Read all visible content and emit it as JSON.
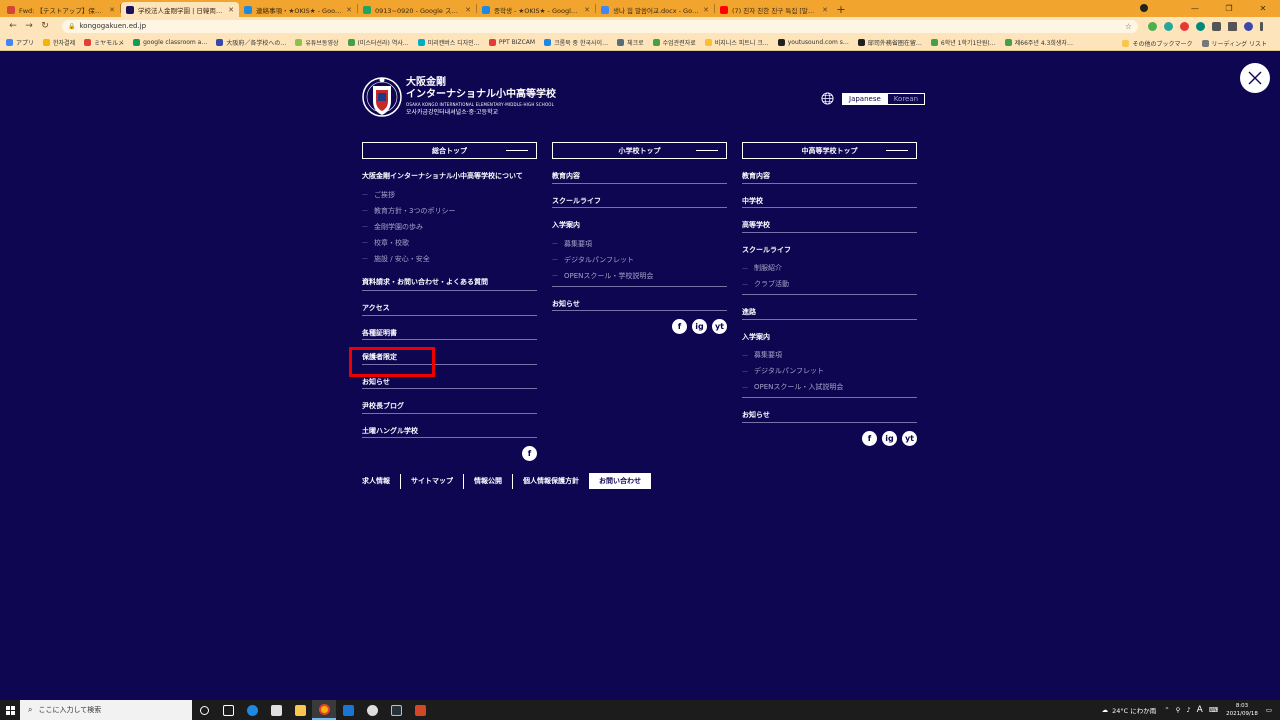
{
  "browser": {
    "tabs": [
      {
        "label": "Fwd: 【テストアップ】保護者ページ:ユ…",
        "icon_color": "#d44638"
      },
      {
        "label": "学校法人金剛学園 | 日韓両国語で…",
        "icon_color": "#1a1060",
        "active": true
      },
      {
        "label": "連絡事項・★OKIS★ - Google ド…",
        "icon_color": "#1e88e5"
      },
      {
        "label": "0913~0920 - Google スプレッドシー…",
        "icon_color": "#1fa463"
      },
      {
        "label": "중학생 - ★OKIS★ - Google ドラ…",
        "icon_color": "#1e88e5"
      },
      {
        "label": "생나 힘 말씀어교.docx - Google…",
        "icon_color": "#4285f4"
      },
      {
        "label": "(7) 친자 친한 친구 특집 [말씀어…",
        "icon_color": "#ff0000"
      }
    ],
    "new_tab": "+",
    "url": "kongogakuen.ed.jp",
    "bookmarks": [
      {
        "label": "アプリ",
        "color": "#4285f4"
      },
      {
        "label": "한자결제",
        "color": "#f4b400"
      },
      {
        "label": "ミヤモルメ",
        "color": "#db4437"
      },
      {
        "label": "google classroom a…",
        "color": "#0f9d58"
      },
      {
        "label": "大阪府／各学校への…",
        "color": "#3949ab"
      },
      {
        "label": "유튜브동영상",
        "color": "#8bc34a"
      },
      {
        "label": "(미스터선라) 역사…",
        "color": "#43a047"
      },
      {
        "label": "미리캔버스 디자인…",
        "color": "#00acc1"
      },
      {
        "label": "PPT BIZCAM",
        "color": "#e53935"
      },
      {
        "label": "크롬북 중 한국사이…",
        "color": "#1e88e5"
      },
      {
        "label": "체크로",
        "color": "#546e7a"
      },
      {
        "label": "수업관련자료",
        "color": "#43a047"
      },
      {
        "label": "비지니스 피트니 크…",
        "color": "#fbc02d"
      },
      {
        "label": "youtusound.com s…",
        "color": "#212121"
      },
      {
        "label": "邸司外務省圏在留…",
        "color": "#212121"
      },
      {
        "label": "6학년 1학기1단원(…",
        "color": "#43a047"
      },
      {
        "label": "제66주년 4.3희생자…",
        "color": "#43a047"
      }
    ],
    "bookmarks_right": [
      "その他のブックマーク",
      "リーディング リスト"
    ]
  },
  "site": {
    "logo": {
      "line1": "大阪金剛",
      "line2": "インターナショナル小中高等学校",
      "line3": "OSAKA KONGO INTERNATIONAL ELEMENTARY·MIDDLE·HIGH SCHOOL",
      "line4": "오사카금강인터내셔널소·중·고등학교"
    },
    "lang": {
      "japanese": "Japanese",
      "korean": "Korean"
    },
    "col1": {
      "heading": "総合トップ",
      "about": "大阪金剛インターナショナル小中高等学校について",
      "about_subs": [
        "ご挨拶",
        "教育方針・3つのポリシー",
        "金剛学園の歩み",
        "校章・校歌",
        "施設 / 安心・安全"
      ],
      "items": [
        "資料請求・お問い合わせ・よくある質問",
        "アクセス",
        "各種証明書",
        "保護者限定",
        "お知らせ",
        "尹校長ブログ",
        "土曜ハングル学校"
      ],
      "social": [
        "f"
      ]
    },
    "col2": {
      "heading": "小学校トップ",
      "items_a": [
        "教育内容",
        "スクールライフ",
        "入学案内"
      ],
      "subs": [
        "募集要項",
        "デジタルパンフレット",
        "OPENスクール・学校説明会"
      ],
      "items_b": [
        "お知らせ"
      ],
      "social": [
        "f",
        "ig",
        "yt"
      ]
    },
    "col3": {
      "heading": "中高等学校トップ",
      "items_a": [
        "教育内容",
        "中学校",
        "高等学校",
        "スクールライフ"
      ],
      "subs_a": [
        "制服紹介",
        "クラブ活動"
      ],
      "items_b": [
        "進路",
        "入学案内"
      ],
      "subs_b": [
        "募集要項",
        "デジタルパンフレット",
        "OPENスクール・入試説明会"
      ],
      "items_c": [
        "お知らせ"
      ],
      "social": [
        "f",
        "ig",
        "yt"
      ]
    },
    "footer": {
      "links": [
        "求人情報",
        "サイトマップ",
        "情報公開",
        "個人情報保護方針"
      ],
      "contact": "お問い合わせ"
    }
  },
  "taskbar": {
    "search_placeholder": "ここに入力して検索",
    "weather": "24°C にわか雨",
    "ime": "A",
    "time": "8:03",
    "date": "2021/09/18"
  }
}
